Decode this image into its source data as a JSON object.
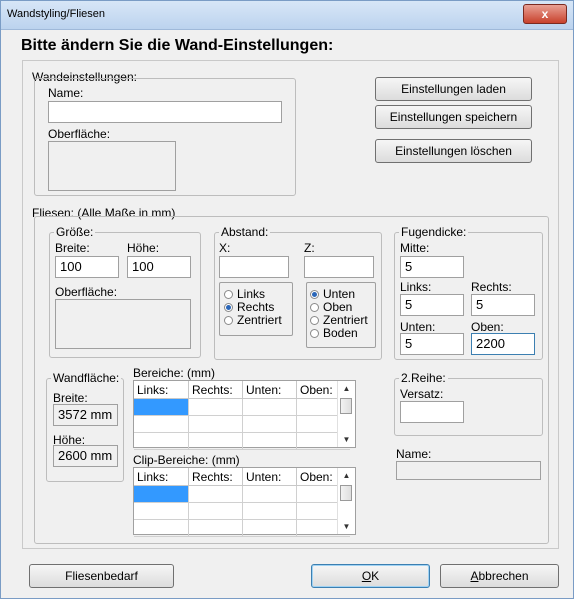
{
  "window": {
    "title": "Wandstyling/Fliesen",
    "close": "x"
  },
  "heading": "Bitte ändern Sie die Wand-Einstellungen:",
  "wall": {
    "group_label": "Wandeinstellungen:",
    "name_label": "Name:",
    "name_value": "",
    "surface_label": "Oberfläche:",
    "btn_load": "Einstellungen laden",
    "btn_save": "Einstellungen speichern",
    "btn_delete": "Einstellungen löschen"
  },
  "tiles": {
    "group_label": "Fliesen: (Alle Maße in mm)",
    "size": {
      "label": "Größe:",
      "width_label": "Breite:",
      "width_value": "100",
      "height_label": "Höhe:",
      "height_value": "100",
      "surface_label": "Oberfläche:"
    },
    "spacing": {
      "label": "Abstand:",
      "x_label": "X:",
      "x_value": "",
      "z_label": "Z:",
      "z_value": "",
      "horizontal": [
        "Links",
        "Rechts",
        "Zentriert"
      ],
      "horizontal_selected": "Rechts",
      "vertical": [
        "Unten",
        "Oben",
        "Zentriert",
        "Boden"
      ],
      "vertical_selected": "Unten"
    },
    "joint": {
      "label": "Fugendicke:",
      "center_label": "Mitte:",
      "center_value": "5",
      "left_label": "Links:",
      "left_value": "5",
      "right_label": "Rechts:",
      "right_value": "5",
      "bottom_label": "Unten:",
      "bottom_value": "5",
      "top_label": "Oben:",
      "top_value": "2200"
    },
    "wallarea": {
      "label": "Wandfläche:",
      "width_label": "Breite:",
      "width_value": "3572 mm",
      "height_label": "Höhe:",
      "height_value": "2600 mm"
    },
    "ranges": {
      "label": "Bereiche: (mm)",
      "columns": [
        "Links:",
        "Rechts:",
        "Unten:",
        "Oben:"
      ]
    },
    "clip_ranges": {
      "label": "Clip-Bereiche: (mm)",
      "columns": [
        "Links:",
        "Rechts:",
        "Unten:",
        "Oben:"
      ]
    },
    "second_row": {
      "label": "2.Reihe:",
      "offset_label": "Versatz:",
      "offset_value": ""
    },
    "name_label": "Name:",
    "name_value": ""
  },
  "footer": {
    "btn_tiles": "Fliesenbedarf",
    "btn_ok_u": "O",
    "btn_ok_rest": "K",
    "btn_cancel_u": "A",
    "btn_cancel_rest": "bbrechen"
  }
}
